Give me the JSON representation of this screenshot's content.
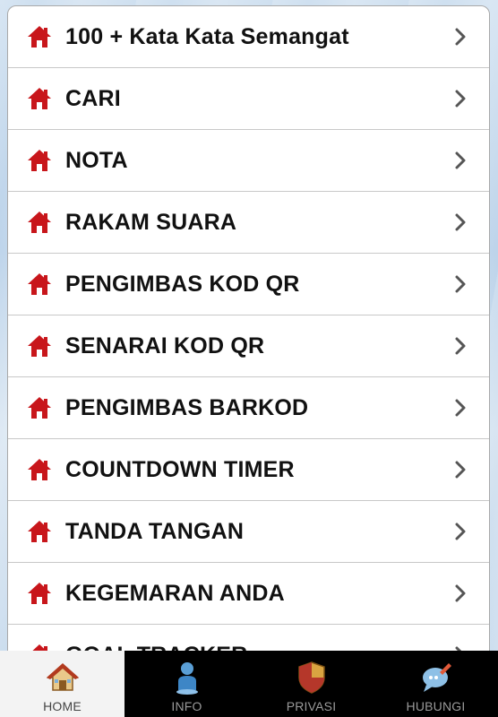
{
  "menu": {
    "items": [
      {
        "label": "100 + Kata Kata Semangat"
      },
      {
        "label": "CARI"
      },
      {
        "label": "NOTA"
      },
      {
        "label": "RAKAM SUARA"
      },
      {
        "label": "PENGIMBAS KOD QR"
      },
      {
        "label": "SENARAI KOD QR"
      },
      {
        "label": "PENGIMBAS BARKOD"
      },
      {
        "label": "COUNTDOWN TIMER"
      },
      {
        "label": "TANDA TANGAN"
      },
      {
        "label": "KEGEMARAN ANDA"
      },
      {
        "label": "GOAL TRACKER"
      }
    ],
    "item_icon": "home-icon",
    "chevron_icon": "chevron-right-icon"
  },
  "tabbar": {
    "tabs": [
      {
        "label": "HOME",
        "icon": "house-icon",
        "active": true
      },
      {
        "label": "INFO",
        "icon": "person-icon",
        "active": false
      },
      {
        "label": "PRIVASI",
        "icon": "shield-icon",
        "active": false
      },
      {
        "label": "HUBUNGI",
        "icon": "chat-bubble-icon",
        "active": false
      }
    ]
  },
  "colors": {
    "house_red": "#c8161b",
    "tab_bar": "#000000",
    "active_tab": "#f3f3f3"
  }
}
